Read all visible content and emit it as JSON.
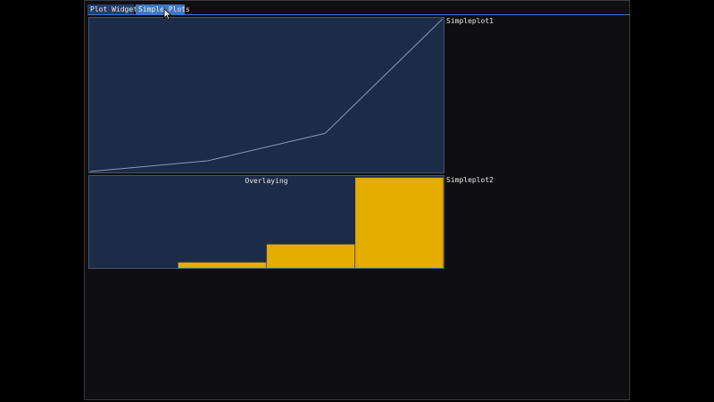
{
  "tabs": [
    {
      "label": "Plot Widget",
      "active": false
    },
    {
      "label": "Simple Plots",
      "active": true
    }
  ],
  "plots": {
    "plot1": {
      "label": "Simpleplot1",
      "line_color": "#8a9ab3"
    },
    "plot2": {
      "label": "Simpleplot2",
      "overlay_text": "Overlaying",
      "bar_color": "#e4ad00",
      "bar_border": "#c49300"
    }
  },
  "colors": {
    "window_bg": "#0f0e10",
    "plot_bg": "#1c2b48",
    "tab_active": "#3f77c5",
    "tab_inactive": "#1e3f6e",
    "text": "#e8e8e8"
  },
  "chart_data": [
    {
      "type": "line",
      "series": [
        {
          "values": [
            0,
            0.07,
            0.25,
            1.0
          ]
        }
      ],
      "x": [
        0,
        1,
        2,
        3
      ],
      "ylim": [
        0,
        1
      ]
    },
    {
      "type": "bar",
      "categories": [
        "1",
        "2",
        "3",
        "4"
      ],
      "values": [
        0,
        0.06,
        0.26,
        1.0
      ],
      "ylim": [
        0,
        1
      ]
    }
  ]
}
